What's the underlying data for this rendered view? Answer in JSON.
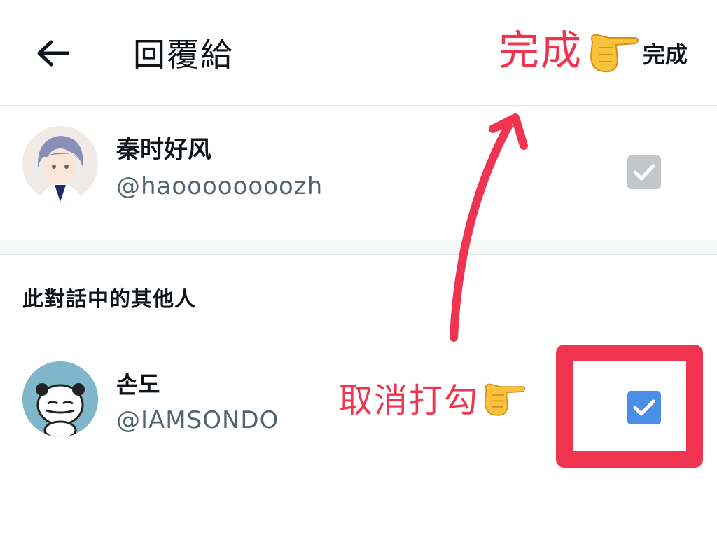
{
  "header": {
    "title": "回覆給",
    "done_label": "完成",
    "back_icon": "arrow-left-icon"
  },
  "primary_user": {
    "name": "秦时好风",
    "handle": "@haoooooooozh",
    "checked": true,
    "checkbox_state": "checked-disabled"
  },
  "section": {
    "title": "此對話中的其他人"
  },
  "others": [
    {
      "name": "손도",
      "handle": "@IAMSONDO",
      "checked": true,
      "checkbox_state": "checked-active"
    }
  ],
  "annotations": {
    "done_note": "完成",
    "uncheck_note": "取消打勾"
  },
  "colors": {
    "accent_blue": "#4a8fe7",
    "disabled_check": "#c4c7ca",
    "annotation_red": "#f0344f",
    "handle_gray": "#536471"
  }
}
